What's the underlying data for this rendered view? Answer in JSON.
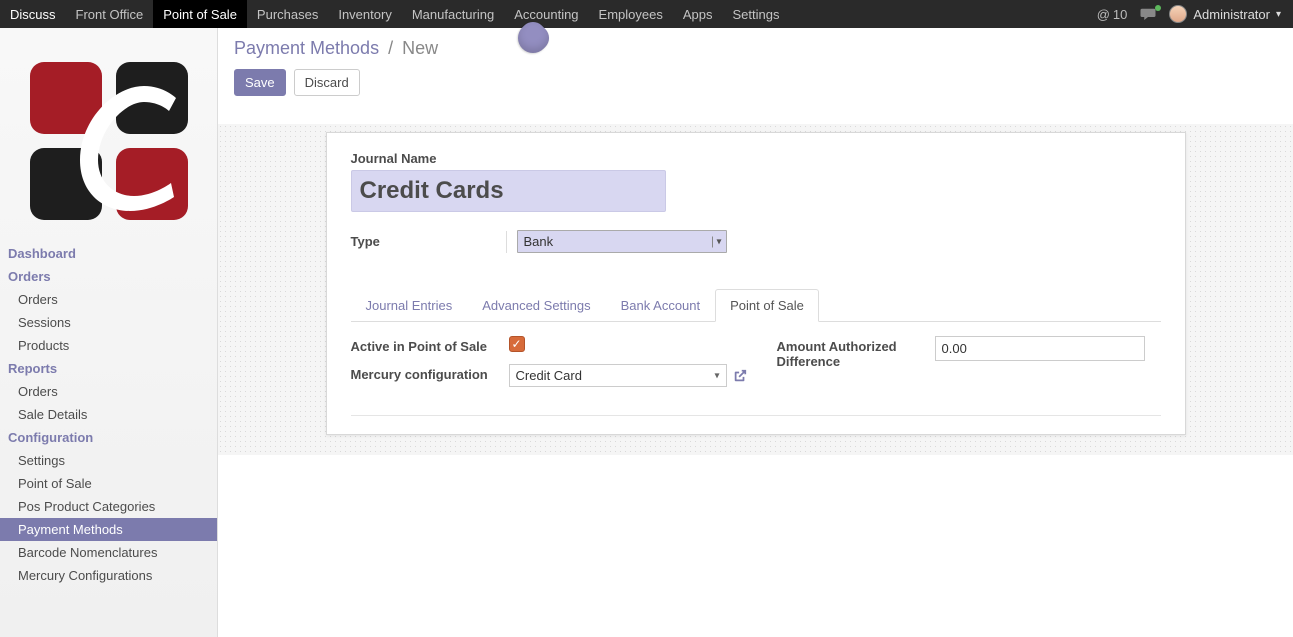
{
  "topnav": {
    "items": [
      "Discuss",
      "Front Office",
      "Point of Sale",
      "Purchases",
      "Inventory",
      "Manufacturing",
      "Accounting",
      "Employees",
      "Apps",
      "Settings"
    ],
    "active_index": 2,
    "mail_count": "10",
    "user_name": "Administrator"
  },
  "sidebar": {
    "sections": [
      {
        "title": "Dashboard",
        "items": []
      },
      {
        "title": "Orders",
        "items": [
          "Orders",
          "Sessions",
          "Products"
        ]
      },
      {
        "title": "Reports",
        "items": [
          "Orders",
          "Sale Details"
        ]
      },
      {
        "title": "Configuration",
        "items": [
          "Settings",
          "Point of Sale",
          "Pos Product Categories",
          "Payment Methods",
          "Barcode Nomenclatures",
          "Mercury Configurations"
        ],
        "active_item_index": 3
      }
    ]
  },
  "breadcrumb": {
    "parent": "Payment Methods",
    "current": "New"
  },
  "actions": {
    "save": "Save",
    "discard": "Discard"
  },
  "form": {
    "journal_name_label": "Journal Name",
    "journal_name_value": "Credit Cards",
    "type_label": "Type",
    "type_value": "Bank",
    "tabs": [
      "Journal Entries",
      "Advanced Settings",
      "Bank Account",
      "Point of Sale"
    ],
    "active_tab_index": 3,
    "pos": {
      "active_label": "Active in Point of Sale",
      "active_checked": true,
      "mercury_label": "Mercury configuration",
      "mercury_value": "Credit Card",
      "amount_diff_label": "Amount Authorized Difference",
      "amount_diff_value": "0.00"
    }
  }
}
